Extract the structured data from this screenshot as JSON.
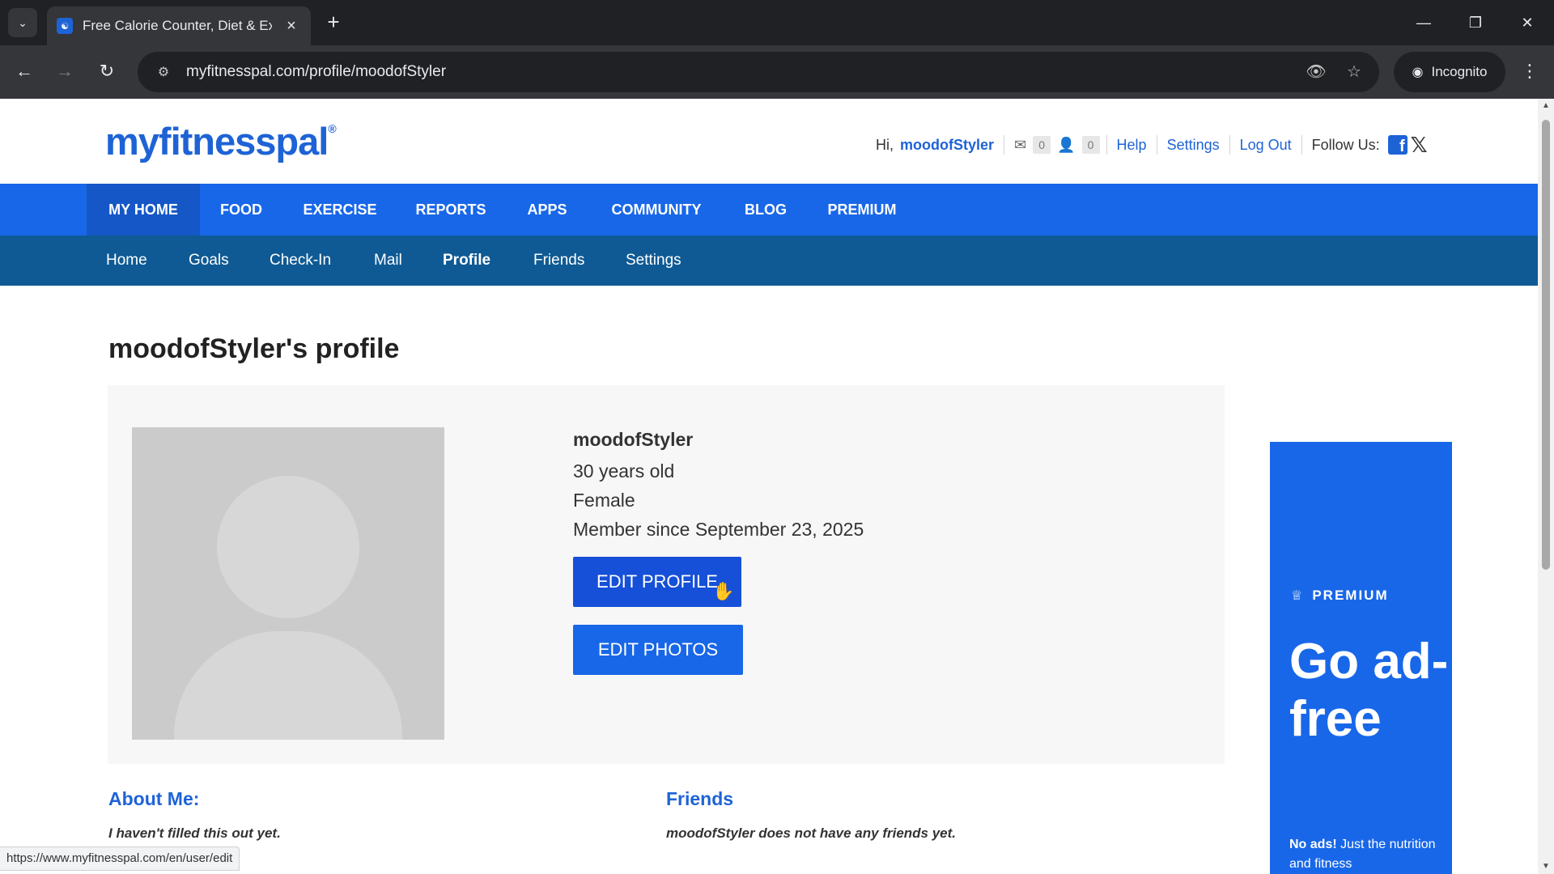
{
  "browser": {
    "tab_title": "Free Calorie Counter, Diet & Ex",
    "url": "myfitnesspal.com/profile/moodofStyler",
    "incognito_label": "Incognito",
    "status_url": "https://www.myfitnesspal.com/en/user/edit",
    "icons": [
      "tab-search-icon",
      "close-icon",
      "plus-icon",
      "minimize-icon",
      "restore-icon",
      "back-icon",
      "forward-icon",
      "reload-icon",
      "site-info-icon",
      "eye-off-icon",
      "star-icon",
      "incognito-icon",
      "kebab-menu-icon"
    ]
  },
  "header": {
    "logo": "myfitnesspal",
    "greeting": "Hi,",
    "username": "moodofStyler",
    "mail_count": "0",
    "friend_request_count": "0",
    "links": [
      "Help",
      "Settings",
      "Log Out"
    ],
    "follow_label": "Follow Us:"
  },
  "main_nav": {
    "items": [
      "MY HOME",
      "FOOD",
      "EXERCISE",
      "REPORTS",
      "APPS",
      "COMMUNITY",
      "BLOG",
      "PREMIUM"
    ],
    "active": "MY HOME"
  },
  "sub_nav": {
    "items": [
      "Home",
      "Goals",
      "Check-In",
      "Mail",
      "Profile",
      "Friends",
      "Settings"
    ],
    "active": "Profile"
  },
  "profile": {
    "title": "moodofStyler's profile",
    "username": "moodofStyler",
    "age": "30 years old",
    "gender": "Female",
    "member_since": "Member since September 23, 2025",
    "edit_profile_label": "EDIT PROFILE",
    "edit_photos_label": "EDIT PHOTOS"
  },
  "about": {
    "heading": "About Me:",
    "text": "I haven't filled this out yet."
  },
  "friends": {
    "heading": "Friends",
    "text": "moodofStyler does not have any friends yet."
  },
  "ad": {
    "badge": "PREMIUM",
    "headline": "Go ad-free",
    "sub_bold": "No ads!",
    "sub_text": "Just the nutrition and fitness"
  },
  "colors": {
    "brand_blue": "#1867e8",
    "subnav_blue": "#0f5a94",
    "link_blue": "#1e63d6"
  }
}
